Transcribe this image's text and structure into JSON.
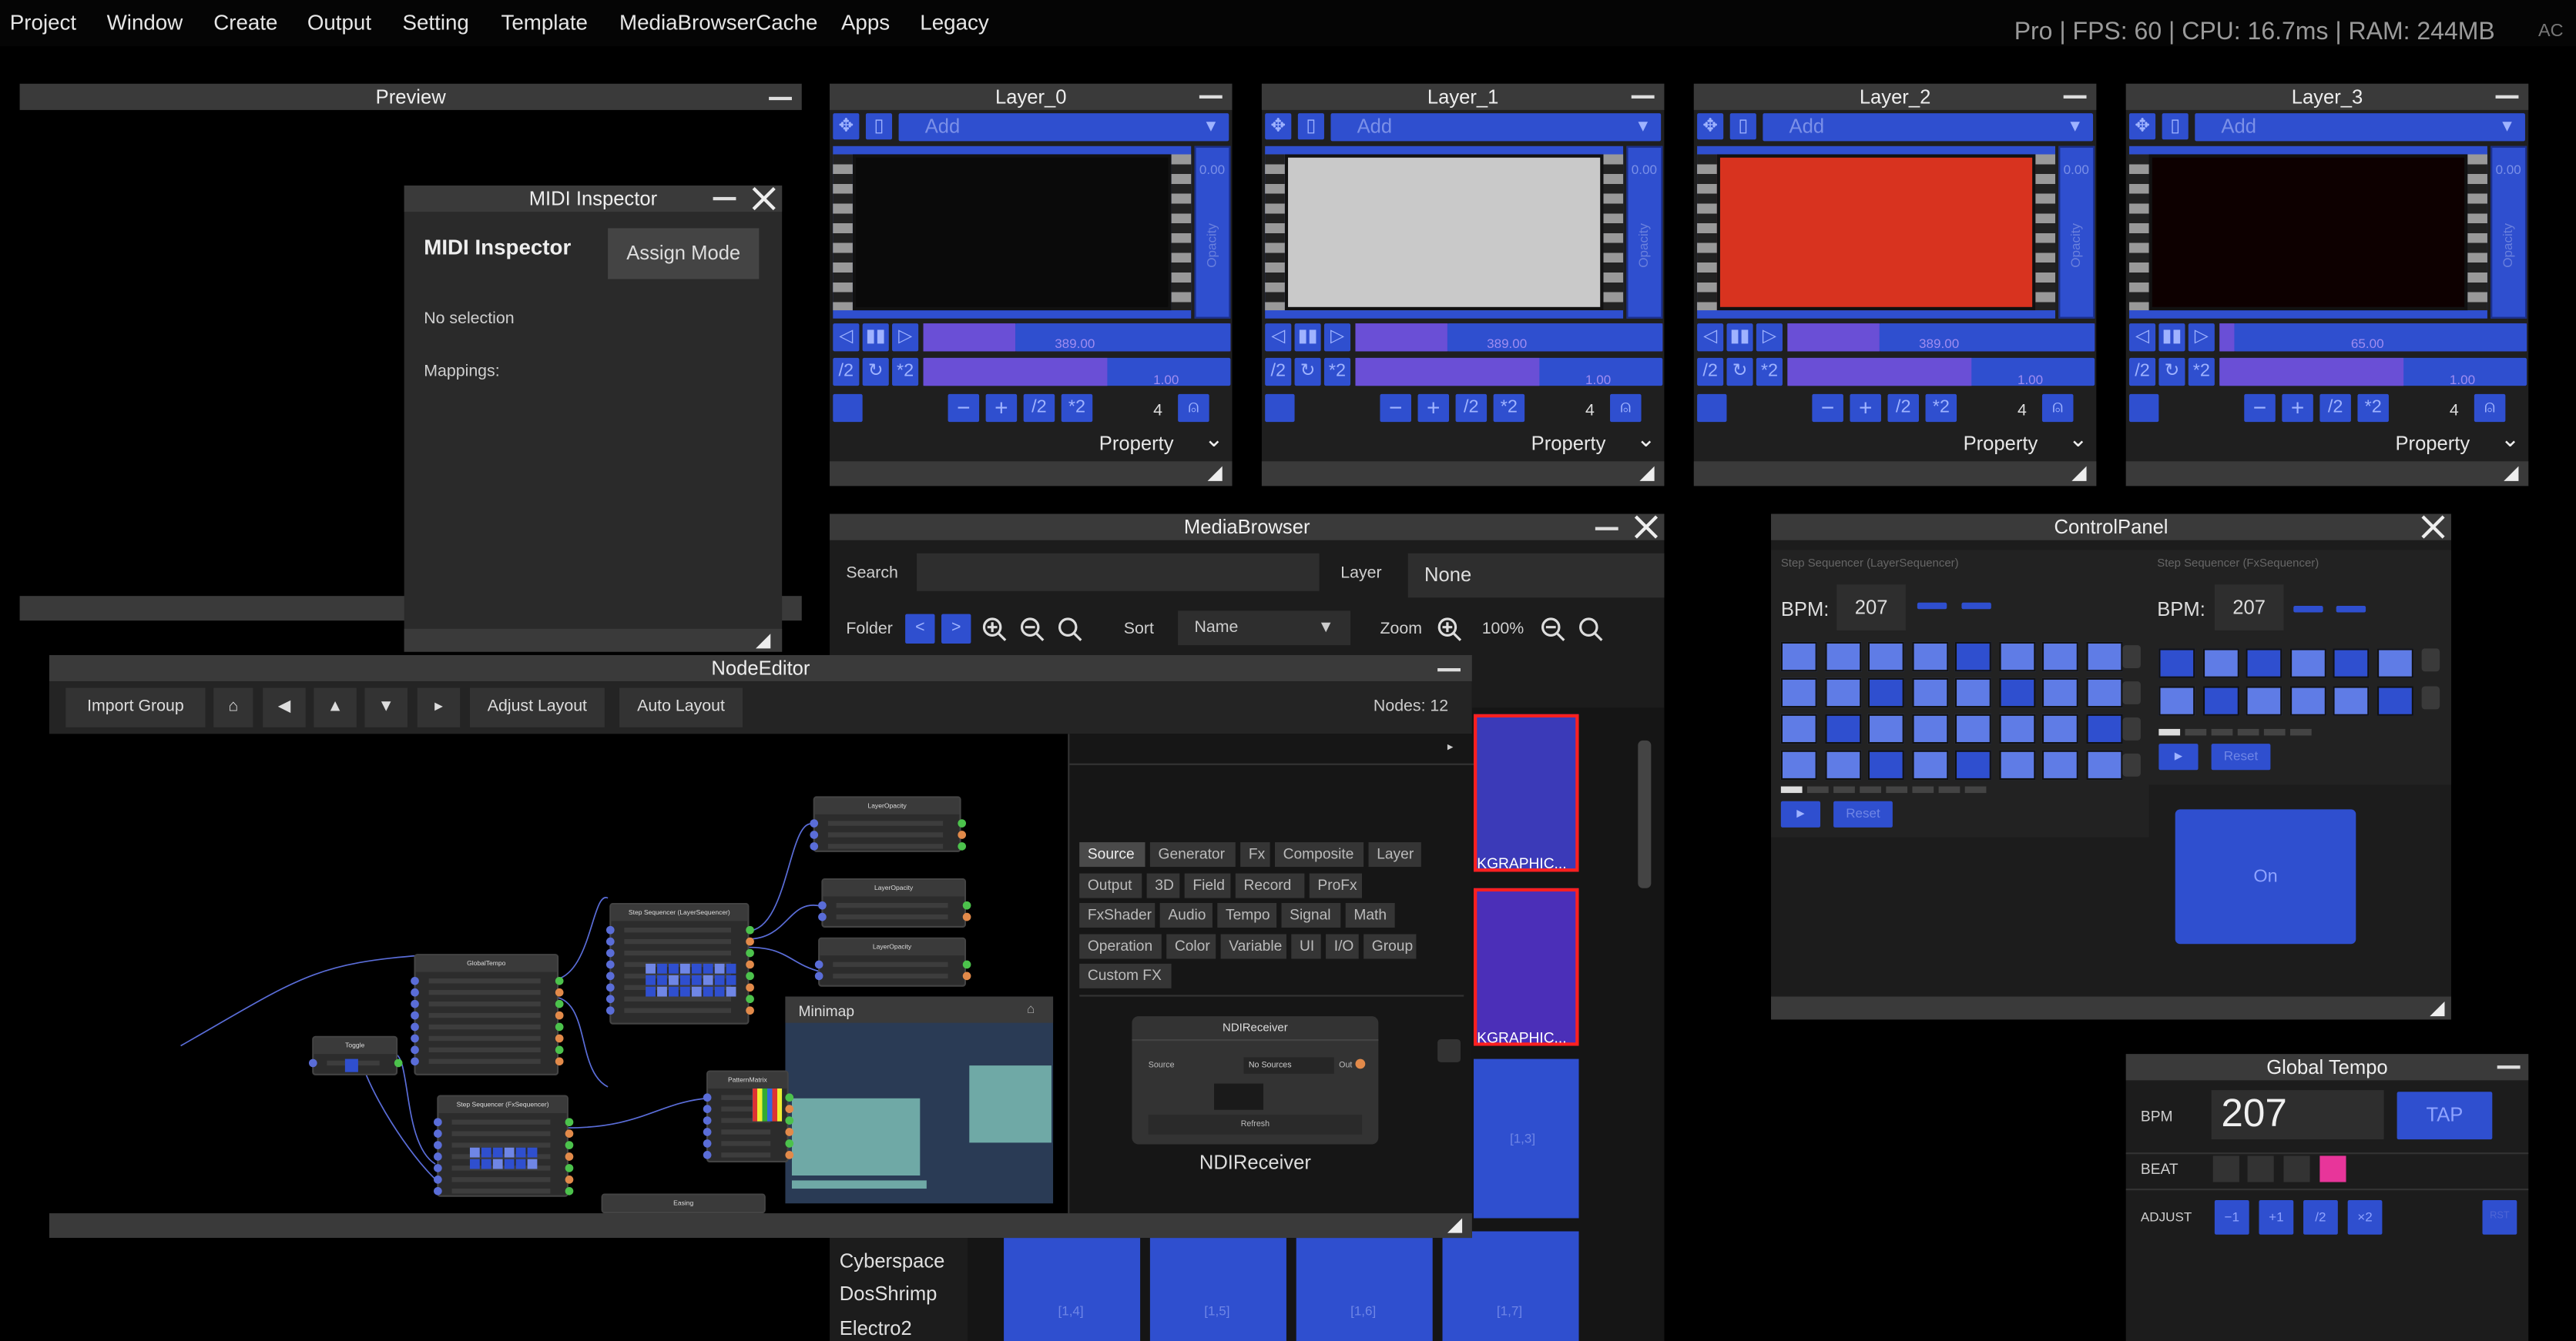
{
  "menu": [
    "Project",
    "Window",
    "Create",
    "Output",
    "Setting",
    "Template",
    "MediaBrowserCache",
    "Apps",
    "Legacy"
  ],
  "stats": "Pro | FPS: 60 | CPU: 16.7ms | RAM: 244MB",
  "stats_extra": "AC",
  "preview": {
    "title": "Preview"
  },
  "midi": {
    "title": "MIDI Inspector",
    "heading": "MIDI Inspector",
    "assign_label": "Assign Mode",
    "no_selection": "No selection",
    "mappings": "Mappings:"
  },
  "layers": [
    {
      "title": "Layer_0",
      "add_placeholder": "Add",
      "opacity_value": "0.00",
      "opacity_label": "Opacity",
      "bar1_value": "389.00",
      "bar2_value": "1.00",
      "bar1_fill": 0.3,
      "count": "4",
      "property": "Property",
      "thumb_color": "#0a0a0a"
    },
    {
      "title": "Layer_1",
      "add_placeholder": "Add",
      "opacity_value": "0.00",
      "opacity_label": "Opacity",
      "bar1_value": "389.00",
      "bar2_value": "1.00",
      "bar1_fill": 0.3,
      "count": "4",
      "property": "Property",
      "thumb_color": "#c9c9c9"
    },
    {
      "title": "Layer_2",
      "add_placeholder": "Add",
      "opacity_value": "0.00",
      "opacity_label": "Opacity",
      "bar1_value": "389.00",
      "bar2_value": "1.00",
      "bar1_fill": 0.3,
      "count": "4",
      "property": "Property",
      "thumb_color": "#d8331f"
    },
    {
      "title": "Layer_3",
      "add_placeholder": "Add",
      "opacity_value": "0.00",
      "opacity_label": "Opacity",
      "bar1_value": "65.00",
      "bar2_value": "1.00",
      "bar1_fill": 0.05,
      "count": "4",
      "property": "Property",
      "thumb_color": "#0d0000"
    }
  ],
  "layer_buttons": {
    "half": "/2",
    "double": "*2",
    "minus": "−",
    "plus": "+"
  },
  "media": {
    "title": "MediaBrowser",
    "search_label": "Search",
    "search_value": "",
    "layer_label": "Layer",
    "layer_value": "None",
    "folder_label": "Folder",
    "sort_label": "Sort",
    "sort_value": "Name",
    "zoom_label": "Zoom",
    "zoom_value": "100%",
    "folders": [
      "Cyberspace",
      "DosShrimp",
      "Electro2"
    ],
    "tiles_labels": [
      "KGRAPHIC...",
      "KGRAPHIC...",
      "[1,3]",
      "[1,4]",
      "[1,5]",
      "[1,6]",
      "[1,7]"
    ]
  },
  "control": {
    "title": "ControlPanel",
    "left_caption": "Step Sequencer (LayerSequencer)",
    "right_caption": "Step Sequencer (FxSequencer)",
    "bpm_label": "BPM:",
    "bpm_left": "207",
    "bpm_right": "207",
    "reset": "Reset",
    "play": "►",
    "on_label": "On",
    "left_steps": [
      1,
      1,
      1,
      1,
      0,
      1,
      1,
      1,
      1,
      1,
      0,
      1,
      1,
      0,
      1,
      1,
      1,
      0,
      1,
      1,
      1,
      1,
      1,
      0,
      1,
      1,
      0,
      1,
      0,
      1,
      1,
      1
    ],
    "right_steps": [
      0,
      1,
      0,
      1,
      0,
      1,
      1,
      0,
      1,
      1,
      1,
      0
    ]
  },
  "tempo": {
    "title": "Global Tempo",
    "bpm_label": "BPM",
    "bpm_value": "207",
    "tap_label": "TAP",
    "beat_label": "BEAT",
    "adjust_label": "ADJUST",
    "adjust_buttons": [
      "−1",
      "+1",
      "/2",
      "×2"
    ],
    "reset_label": "RST",
    "beat_active_color": "#e8359a"
  },
  "node_editor": {
    "title": "NodeEditor",
    "toolbar": [
      "Import Group",
      "⌂",
      "◀",
      "▲",
      "▼",
      "▸",
      "Adjust Layout",
      "Auto Layout"
    ],
    "nodes_count": "Nodes: 12",
    "minimap_label": "Minimap",
    "categories": [
      [
        "Source",
        "Generator",
        "Fx",
        "Composite",
        "Layer"
      ],
      [
        "Output",
        "3D",
        "Field",
        "Record",
        "ProFx"
      ],
      [
        "FxShader",
        "Audio",
        "Tempo",
        "Signal",
        "Math"
      ],
      [
        "Operation",
        "Color",
        "Variable",
        "UI",
        "I/O",
        "Group"
      ],
      [
        "Custom FX"
      ]
    ],
    "ndi_title": "NDIReceiver",
    "ndi_source_label": "Source",
    "ndi_source_value": "No Sources",
    "ndi_out": "Out",
    "ndi_refresh": "Refresh",
    "ndi_name": "NDIReceiver",
    "graph_nodes": [
      "GlobalTempo",
      "Step Sequencer (LayerSequencer)",
      "Step Sequencer (FxSequencer)",
      "Toggle",
      "LayerOpacity",
      "LayerOpacity",
      "LayerOpacity",
      "PatternMatrix",
      "Easing"
    ]
  },
  "colors": {
    "accent": "#2f4fcf",
    "purple": "#6a4fd6",
    "panel": "#222222",
    "titlebar": "#3a3a3a",
    "selection_red": "#ff2020"
  }
}
